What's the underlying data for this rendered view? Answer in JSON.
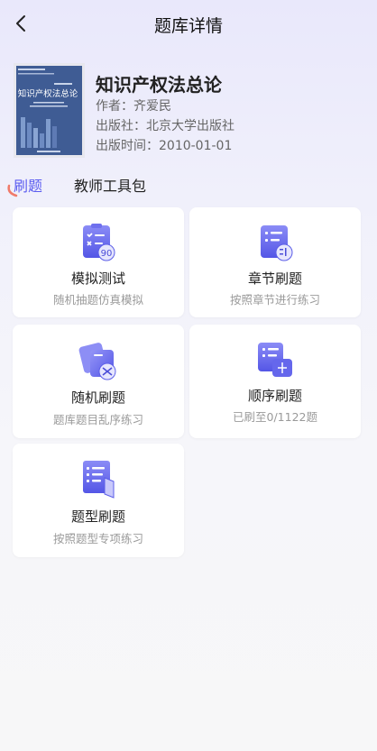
{
  "header": {
    "title": "题库详情"
  },
  "book": {
    "title": "知识产权法总论",
    "author": "作者：齐爱民",
    "publisher": "出版社：北京大学出版社",
    "publish_date": "出版时间：2010-01-01",
    "cover_title": "知识产权法总论",
    "cover_color": "#3f5c94"
  },
  "tabs": [
    {
      "label": "刷题",
      "active": true
    },
    {
      "label": "教师工具包",
      "active": false
    }
  ],
  "accent_color": "#5b5cf0",
  "modules": [
    {
      "title": "模拟测试",
      "subtitle": "随机抽题仿真模拟",
      "icon": "clipboard-exam-icon",
      "badge": "90"
    },
    {
      "title": "章节刷题",
      "subtitle": "按照章节进行练习",
      "icon": "chapter-list-icon"
    },
    {
      "title": "随机刷题",
      "subtitle": "题库题目乱序练习",
      "icon": "shuffle-cards-icon"
    },
    {
      "title": "顺序刷题",
      "subtitle": "已刷至0/1122题",
      "icon": "sequence-list-icon"
    },
    {
      "title": "题型刷题",
      "subtitle": "按照题型专项练习",
      "icon": "question-type-book-icon"
    }
  ]
}
